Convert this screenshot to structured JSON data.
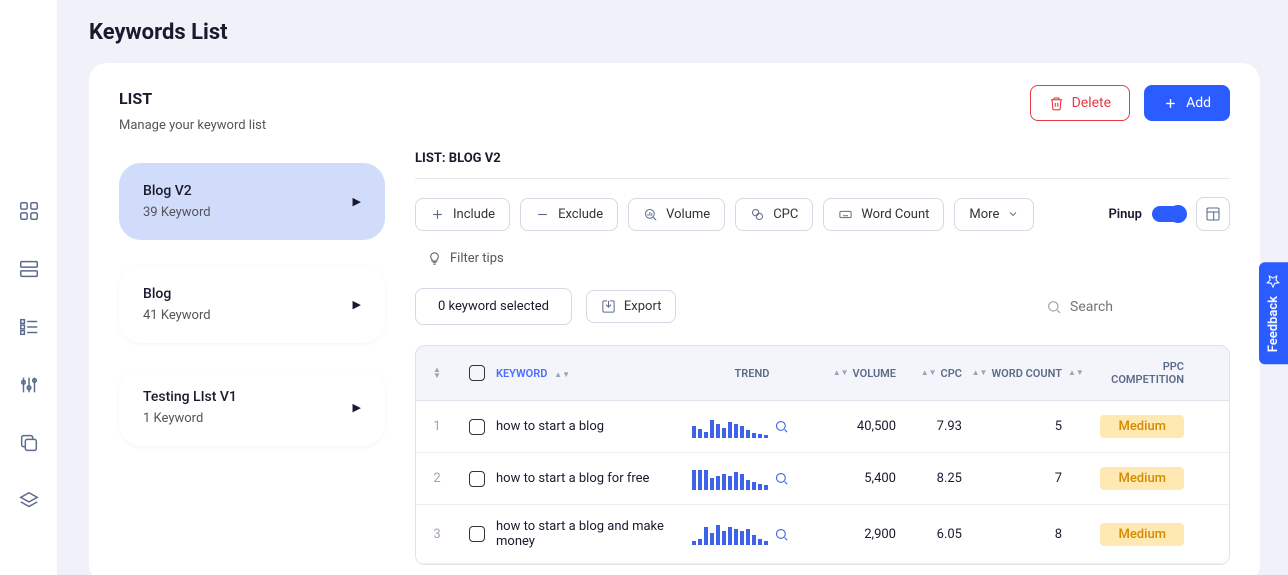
{
  "page_title": "Keywords List",
  "list_panel": {
    "heading": "LIST",
    "subtitle": "Manage your keyword list"
  },
  "lists": [
    {
      "title": "Blog V2",
      "count": "39 Keyword",
      "active": true
    },
    {
      "title": "Blog",
      "count": "41 Keyword",
      "active": false
    },
    {
      "title": "Testing LIst V1",
      "count": "1 Keyword",
      "active": false
    }
  ],
  "actions": {
    "delete": "Delete",
    "add": "Add"
  },
  "current_list_label": "LIST: BLOG V2",
  "filters": {
    "include": "Include",
    "exclude": "Exclude",
    "volume": "Volume",
    "cpc": "CPC",
    "word_count": "Word Count",
    "more": "More",
    "pinup_label": "Pinup",
    "filter_tips": "Filter tips"
  },
  "selection": {
    "selected_text": "0 keyword selected",
    "export": "Export",
    "search_placeholder": "Search"
  },
  "table": {
    "headers": {
      "keyword": "KEYWORD",
      "trend": "TREND",
      "volume": "VOLUME",
      "cpc": "CPC",
      "word_count": "WORD COUNT",
      "ppc": "PPC COMPETITION"
    },
    "rows": [
      {
        "idx": "1",
        "keyword": "how to start a blog",
        "trend_bars": [
          12,
          9,
          6,
          18,
          14,
          10,
          16,
          14,
          12,
          8,
          5,
          4,
          3
        ],
        "volume": "40,500",
        "cpc": "7.93",
        "wc": "5",
        "ppc": "Medium"
      },
      {
        "idx": "2",
        "keyword": "how to start a blog for free",
        "trend_bars": [
          20,
          20,
          20,
          12,
          14,
          16,
          14,
          18,
          16,
          10,
          8,
          6,
          5
        ],
        "volume": "5,400",
        "cpc": "8.25",
        "wc": "7",
        "ppc": "Medium"
      },
      {
        "idx": "3",
        "keyword": "how to start a blog and make money",
        "trend_bars": [
          4,
          6,
          18,
          12,
          20,
          14,
          18,
          16,
          14,
          16,
          10,
          6,
          4
        ],
        "volume": "2,900",
        "cpc": "6.05",
        "wc": "8",
        "ppc": "Medium"
      }
    ]
  },
  "feedback_label": "Feedback"
}
